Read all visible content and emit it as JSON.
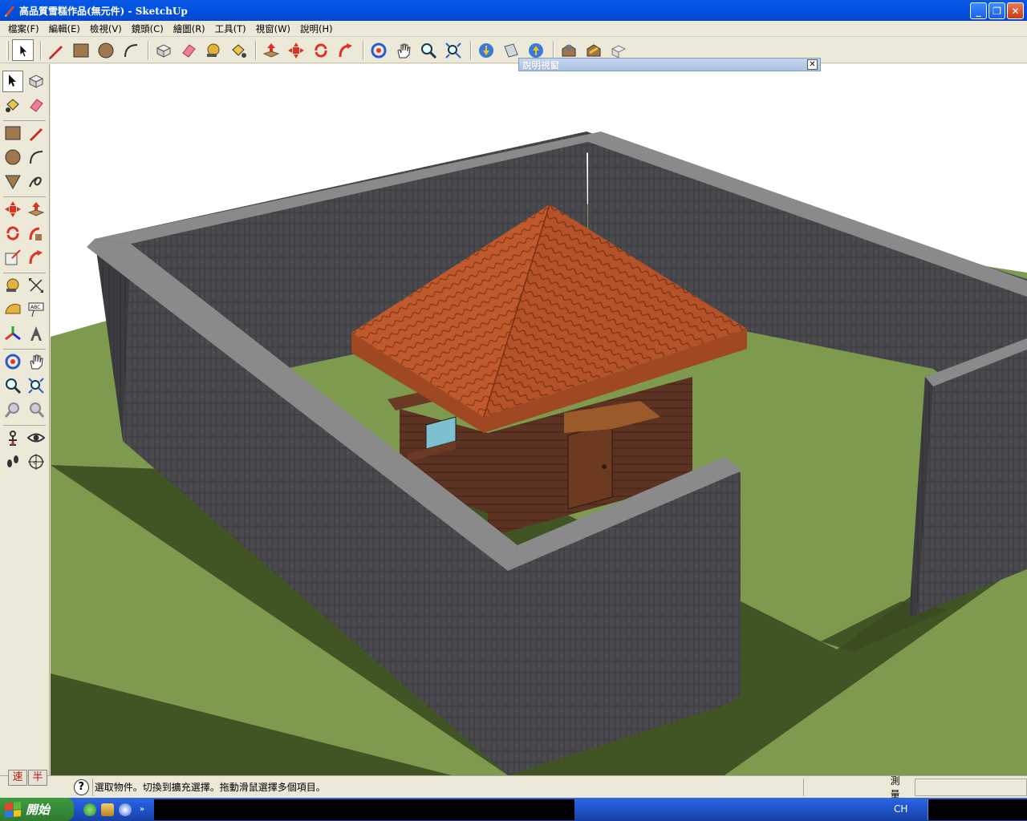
{
  "window": {
    "title": "高品質雪糕作品(無元件) - SketchUp",
    "minimize": "_",
    "restore": "❐",
    "close": "✕"
  },
  "menu": [
    "檔案(F)",
    "編輯(E)",
    "檢視(V)",
    "鏡頭(C)",
    "繪圖(R)",
    "工具(T)",
    "視窗(W)",
    "說明(H)"
  ],
  "toolbar_icons": [
    "select-arrow-icon",
    "pencil-icon",
    "rectangle-icon",
    "circle-icon",
    "arc-icon",
    "eraser-icon",
    "paint-bucket-icon",
    "tape-measure-icon",
    "push-pull-icon",
    "move-icon",
    "rotate-icon",
    "follow-me-icon",
    "orbit-icon",
    "pan-icon",
    "zoom-icon",
    "zoom-extents-icon",
    "get-models-icon",
    "share-model-icon",
    "components-icon"
  ],
  "help_window": {
    "title": "說明視窗",
    "close": "✕"
  },
  "status": {
    "ime_left": "速",
    "ime_right": "半",
    "help_icon": "?",
    "text": "選取物件。切換到擴充選擇。拖動滑鼠選擇多個項目。",
    "measure_label": "測量",
    "measure_value": ""
  },
  "taskbar": {
    "start_label": "開始",
    "more": "»",
    "tray_lang": "CH"
  },
  "colors": {
    "wall": "#4a4a4e",
    "wall_top": "#8a8a8a",
    "grass": "#7e9a4e",
    "shadow": "#3b4d20",
    "roof": "#b9532a",
    "wood": "#5c3322",
    "sky": "#ffffff"
  }
}
